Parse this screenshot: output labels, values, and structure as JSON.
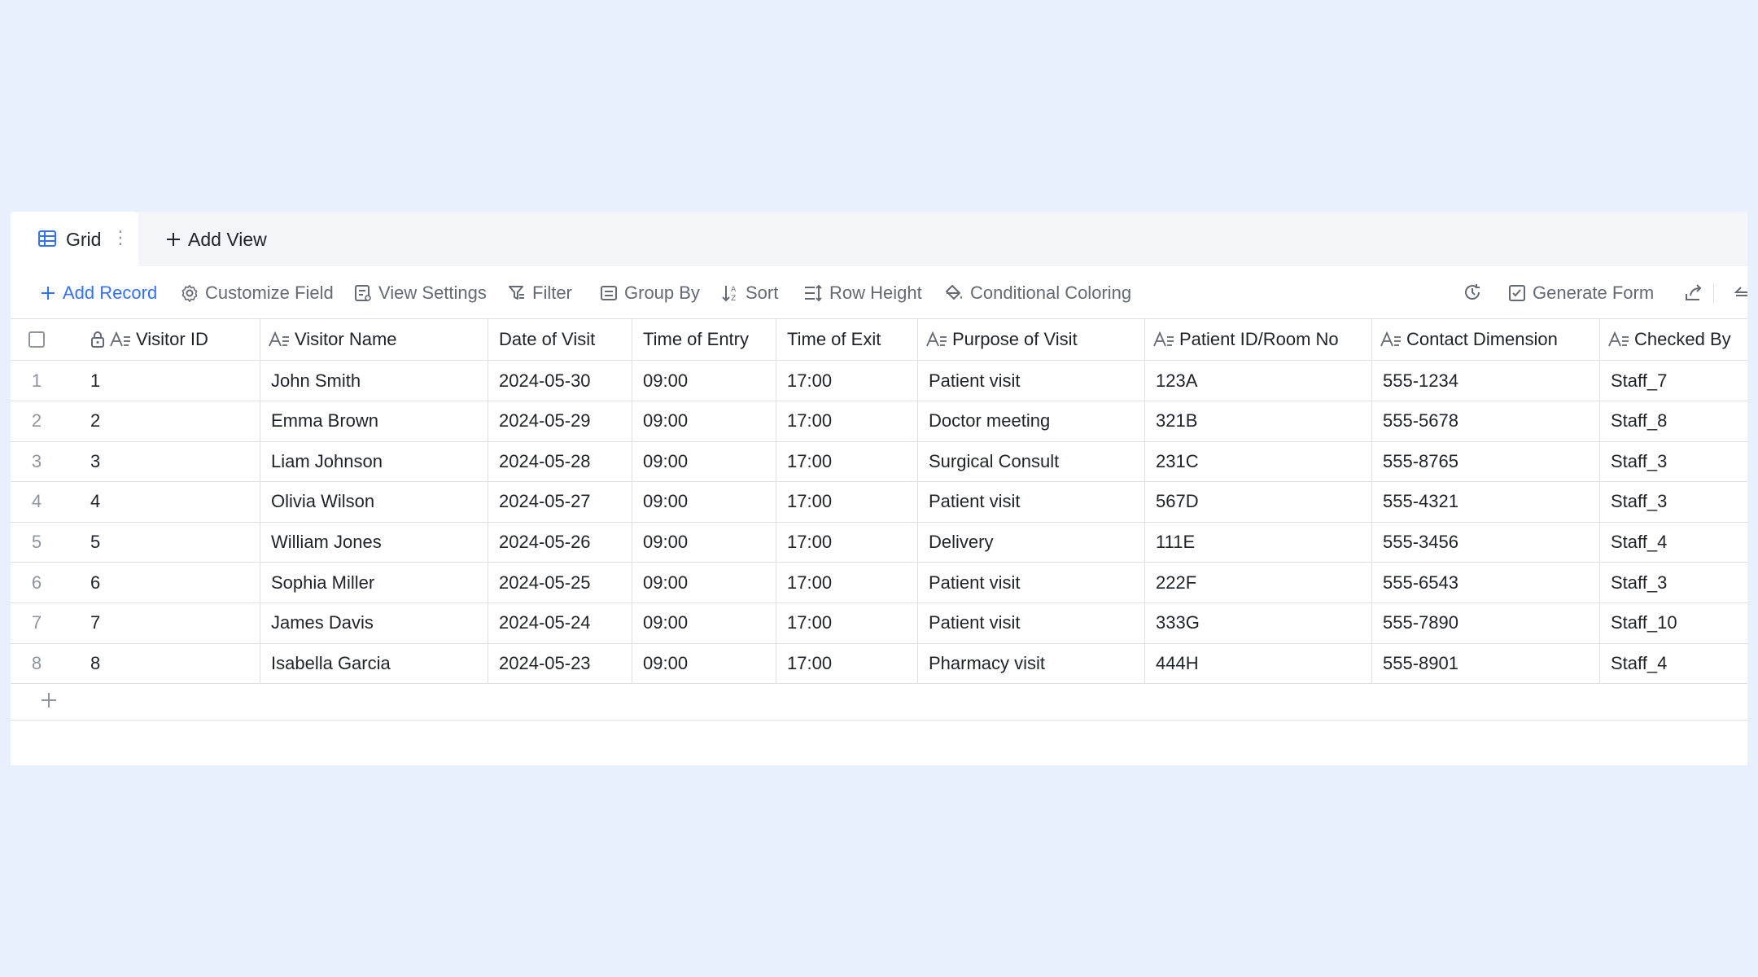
{
  "view_tabs": {
    "active_label": "Grid",
    "add_view_label": "Add View"
  },
  "toolbar": {
    "add_record": "Add Record",
    "customize_field": "Customize Field",
    "view_settings": "View Settings",
    "filter": "Filter",
    "group_by": "Group By",
    "sort": "Sort",
    "row_height": "Row Height",
    "conditional_coloring": "Conditional Coloring",
    "generate_form": "Generate Form",
    "accent_color": "#3370ff"
  },
  "table": {
    "columns": [
      {
        "label": "Visitor ID",
        "icon": "text-field-icon",
        "locked": true
      },
      {
        "label": "Visitor Name",
        "icon": "text-field-icon"
      },
      {
        "label": "Date of Visit"
      },
      {
        "label": "Time of Entry"
      },
      {
        "label": "Time of Exit"
      },
      {
        "label": "Purpose of Visit",
        "icon": "text-field-icon"
      },
      {
        "label": "Patient ID/Room No",
        "icon": "text-field-icon"
      },
      {
        "label": "Contact Dimension",
        "icon": "text-field-icon"
      },
      {
        "label": "Checked By",
        "icon": "text-field-icon"
      }
    ],
    "rows": [
      {
        "num": "1",
        "cells": [
          "1",
          "John Smith",
          "2024-05-30",
          "09:00",
          "17:00",
          "Patient visit",
          "123A",
          "555-1234",
          "Staff_7"
        ]
      },
      {
        "num": "2",
        "cells": [
          "2",
          "Emma Brown",
          "2024-05-29",
          "09:00",
          "17:00",
          "Doctor meeting",
          "321B",
          "555-5678",
          "Staff_8"
        ]
      },
      {
        "num": "3",
        "cells": [
          "3",
          "Liam Johnson",
          "2024-05-28",
          "09:00",
          "17:00",
          "Surgical Consult",
          "231C",
          "555-8765",
          "Staff_3"
        ]
      },
      {
        "num": "4",
        "cells": [
          "4",
          "Olivia Wilson",
          "2024-05-27",
          "09:00",
          "17:00",
          "Patient visit",
          "567D",
          "555-4321",
          "Staff_3"
        ]
      },
      {
        "num": "5",
        "cells": [
          "5",
          "William Jones",
          "2024-05-26",
          "09:00",
          "17:00",
          "Delivery",
          "111E",
          "555-3456",
          "Staff_4"
        ]
      },
      {
        "num": "6",
        "cells": [
          "6",
          "Sophia Miller",
          "2024-05-25",
          "09:00",
          "17:00",
          "Patient visit",
          "222F",
          "555-6543",
          "Staff_3"
        ]
      },
      {
        "num": "7",
        "cells": [
          "7",
          "James Davis",
          "2024-05-24",
          "09:00",
          "17:00",
          "Patient visit",
          "333G",
          "555-7890",
          "Staff_10"
        ]
      },
      {
        "num": "8",
        "cells": [
          "8",
          "Isabella Garcia",
          "2024-05-23",
          "09:00",
          "17:00",
          "Pharmacy visit",
          "444H",
          "555-8901",
          "Staff_4"
        ]
      }
    ]
  }
}
